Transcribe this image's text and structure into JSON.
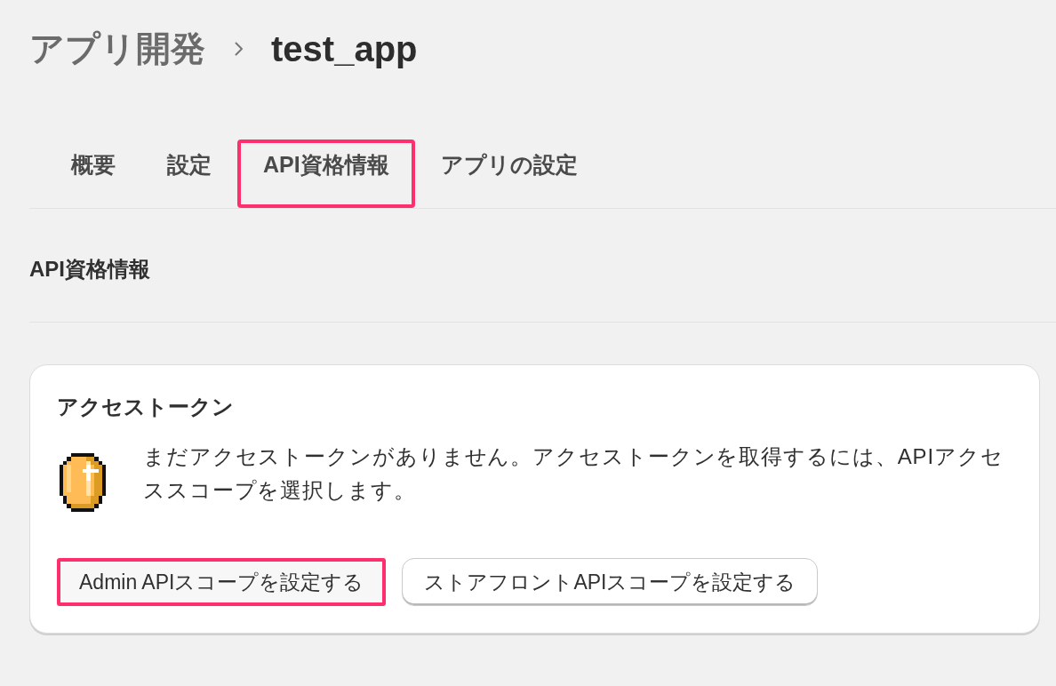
{
  "breadcrumb": {
    "parent": "アプリ開発",
    "current": "test_app"
  },
  "tabs": [
    {
      "label": "概要",
      "highlighted": false
    },
    {
      "label": "設定",
      "highlighted": false
    },
    {
      "label": "API資格情報",
      "highlighted": true
    },
    {
      "label": "アプリの設定",
      "highlighted": false
    }
  ],
  "section": {
    "title": "API資格情報"
  },
  "card": {
    "title": "アクセストークン",
    "message": "まだアクセストークンがありません。アクセストークンを取得するには、APIアクセススコープを選択します。",
    "buttons": [
      {
        "label": "Admin APIスコープを設定する",
        "highlighted": true
      },
      {
        "label": "ストアフロントAPIスコープを設定する",
        "highlighted": false
      }
    ]
  }
}
